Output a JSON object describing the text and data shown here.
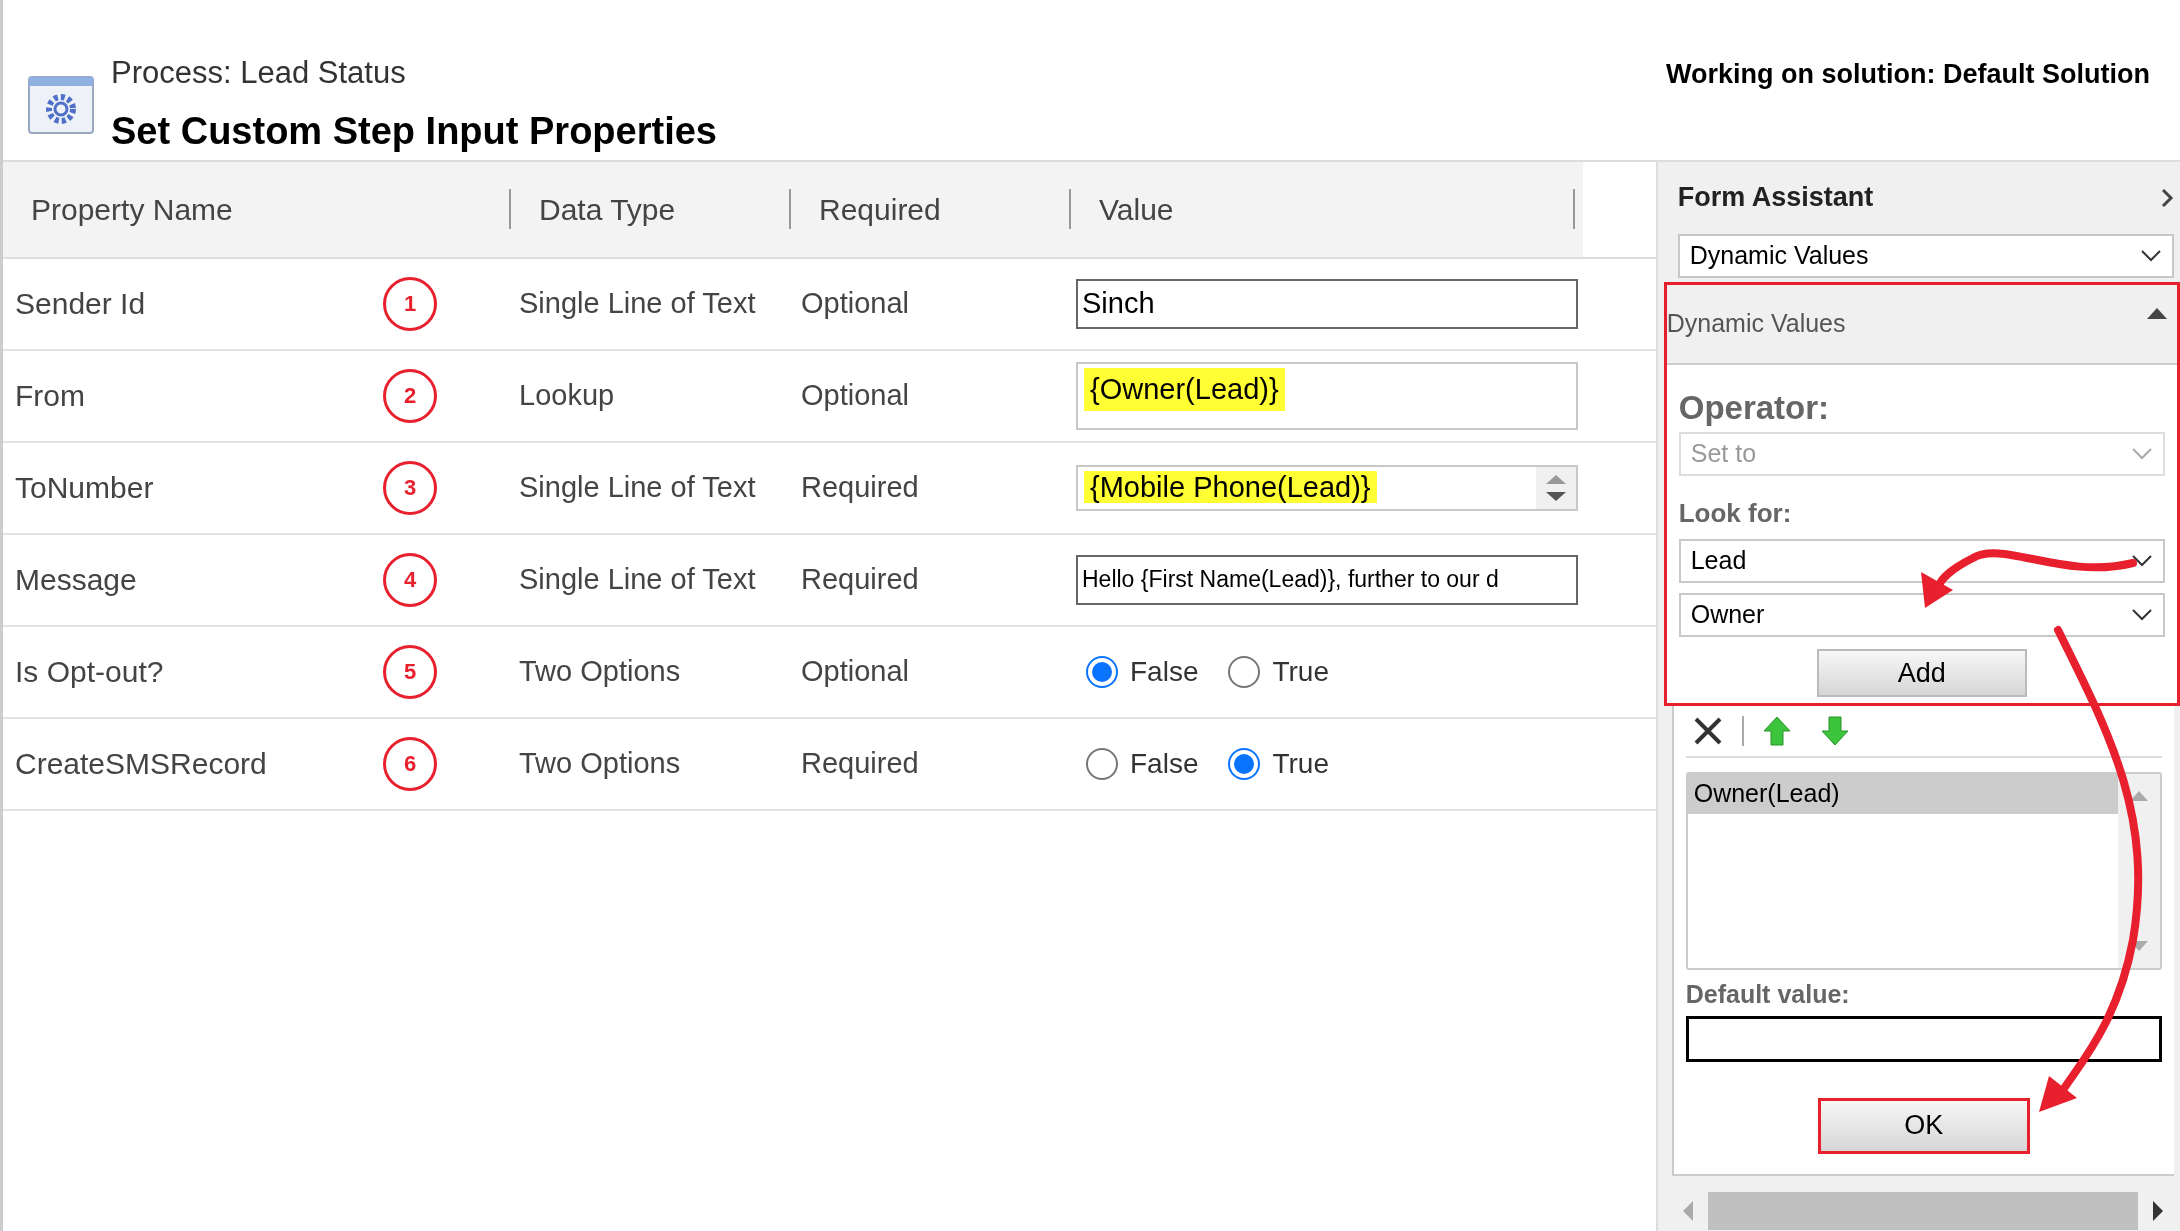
{
  "header": {
    "subtitle": "Process: Lead Status",
    "title": "Set Custom Step Input Properties",
    "solution": "Working on solution: Default Solution"
  },
  "table": {
    "columns": [
      "Property Name",
      "Data Type",
      "Required",
      "Value"
    ],
    "rows": [
      {
        "property": "Sender Id",
        "marker": "1",
        "data_type": "Single Line of Text",
        "required": "Optional",
        "value": {
          "kind": "text",
          "text": "Sinch",
          "highlighted": false
        }
      },
      {
        "property": "From",
        "marker": "2",
        "data_type": "Lookup",
        "required": "Optional",
        "value": {
          "kind": "lookup",
          "text": "{Owner(Lead)}",
          "highlighted": true
        }
      },
      {
        "property": "ToNumber",
        "marker": "3",
        "data_type": "Single Line of Text",
        "required": "Required",
        "value": {
          "kind": "spinner",
          "text": "{Mobile Phone(Lead)}",
          "highlighted": true
        }
      },
      {
        "property": "Message",
        "marker": "4",
        "data_type": "Single Line of Text",
        "required": "Required",
        "value": {
          "kind": "text",
          "text": "Hello {First Name(Lead)}, further to our d",
          "highlighted": false
        }
      },
      {
        "property": "Is Opt-out?",
        "marker": "5",
        "data_type": "Two Options",
        "required": "Optional",
        "value": {
          "kind": "radio",
          "options": [
            {
              "label": "False",
              "selected": true
            },
            {
              "label": "True",
              "selected": false
            }
          ]
        }
      },
      {
        "property": "CreateSMSRecord",
        "marker": "6",
        "data_type": "Two Options",
        "required": "Required",
        "value": {
          "kind": "radio",
          "options": [
            {
              "label": "False",
              "selected": false
            },
            {
              "label": "True",
              "selected": true
            }
          ]
        }
      }
    ]
  },
  "form_assistant": {
    "title": "Form Assistant",
    "mode": "Dynamic Values",
    "section": {
      "title": "Dynamic Values",
      "expanded": true
    },
    "operator_label": "Operator:",
    "operator": {
      "value": "Set to",
      "disabled": true
    },
    "look_for_label": "Look for:",
    "look_for": "Lead",
    "attribute": "Owner",
    "add_button": "Add",
    "list": [
      {
        "label": "Owner(Lead)",
        "selected": true
      }
    ],
    "default_label": "Default value:",
    "ok_button": "OK"
  }
}
